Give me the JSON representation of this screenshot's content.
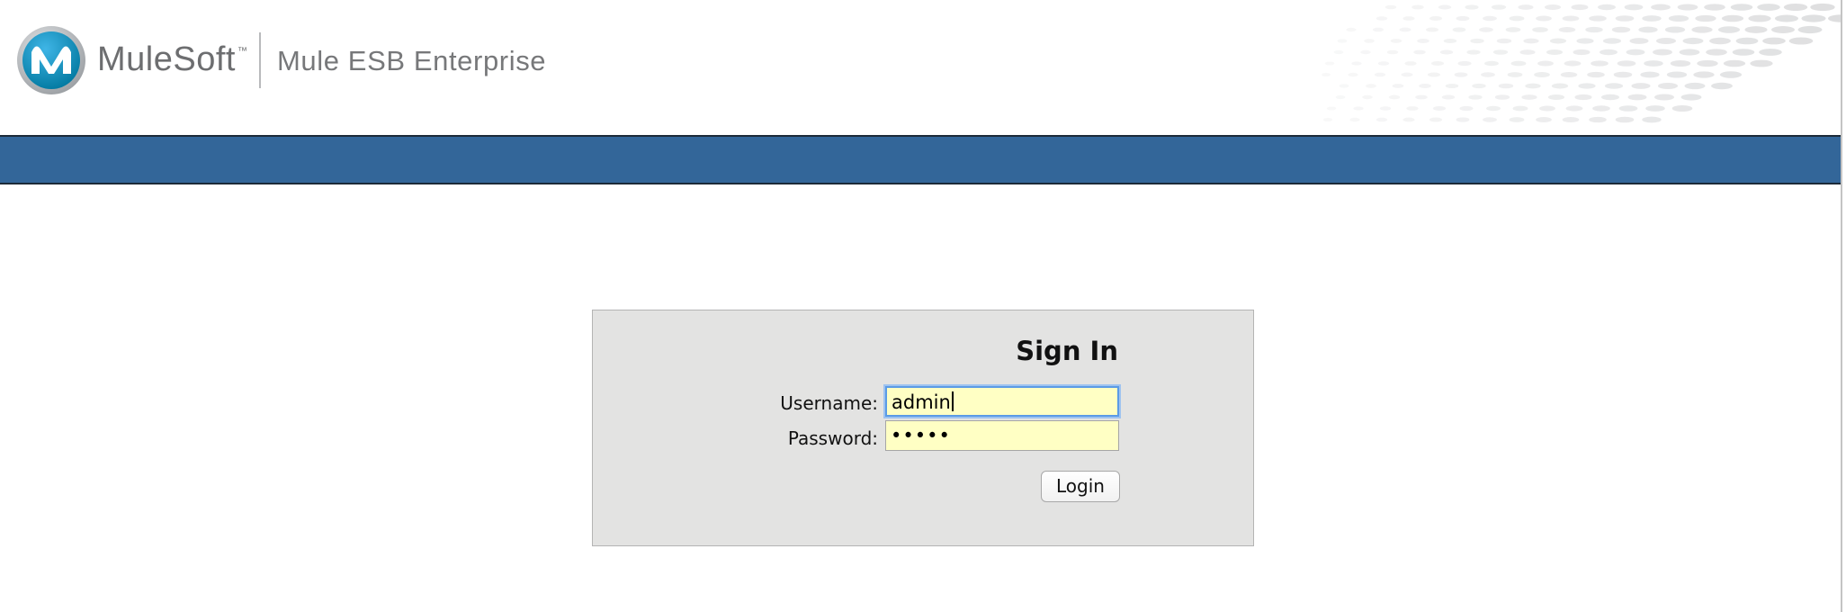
{
  "header": {
    "brand_name": "MuleSoft",
    "brand_trademark": "™",
    "product_name": "Mule ESB Enterprise",
    "logo_icon": "mulesoft-logo-icon"
  },
  "colors": {
    "navbar": "#336699",
    "panel_background": "#e3e3e2",
    "input_background": "#ffffc4",
    "focus_ring": "#5b9be6"
  },
  "signin": {
    "title": "Sign In",
    "username_label": "Username:",
    "username_value": "admin",
    "password_label": "Password:",
    "password_value": "•••••",
    "login_button": "Login"
  }
}
